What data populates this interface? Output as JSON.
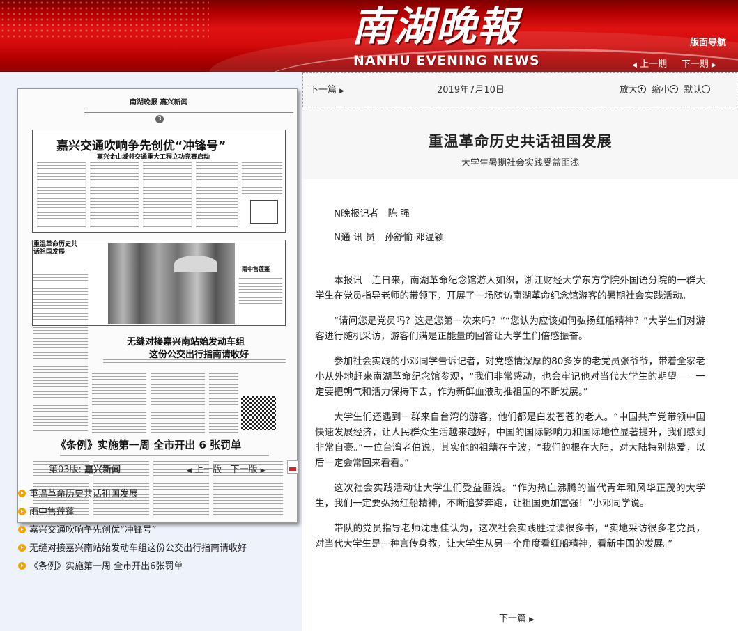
{
  "header": {
    "logo_cn": "南湖晚報",
    "logo_en": "NANHU EVENING NEWS",
    "nav_title": "版面导航",
    "prev_issue": "上一期",
    "next_issue": "下一期"
  },
  "paper_thumb": {
    "masthead": "南湖晚报  嘉兴新闻",
    "page_number": "3",
    "headlines": [
      "嘉兴交通吹响争先创优“冲锋号”",
      "嘉兴金山域邻交通重大工程立功竞赛启动",
      "重温革命历史共话祖国发展",
      "雨中售莲蓬",
      "无缝对接嘉兴南站始发动车组",
      "这份公交出行指南请收好",
      "《条例》实施第一周  全市开出 6 张罚单"
    ]
  },
  "page_nav": {
    "page_label": "第03版:",
    "page_name": "嘉兴新闻",
    "prev_page": "上一版",
    "next_page": "下一版"
  },
  "article_list": [
    "重温革命历史共话祖国发展",
    "雨中售莲蓬",
    "嘉兴交通吹响争先创优“冲锋号”",
    "无缝对接嘉兴南站始发动车组这份公交出行指南请收好",
    "《条例》实施第一周 全市开出6张罚单"
  ],
  "toolbar": {
    "next_article": "下一篇",
    "date": "2019年7月10日",
    "zoom_in": "放大",
    "zoom_out": "缩小",
    "zoom_default": "默认"
  },
  "article": {
    "title": "重温革命历史共话祖国发展",
    "subtitle": "大学生暑期社会实践受益匪浅",
    "byline1": "N晚报记者　陈 强",
    "byline2": "N通 讯 员　孙舒愉 邓温颖",
    "paragraphs": [
      "本报讯　连日来，南湖革命纪念馆游人如织，浙江财经大学东方学院外国语分院的一群大学生在党员指导老师的带领下，开展了一场随访南湖革命纪念馆游客的暑期社会实践活动。",
      "“请问您是党员吗？这是您第一次来吗？”“您认为应该如何弘扬红船精神？”大学生们对游客进行随机采访，游客们满是正能量的回答让大学生们倍感振奋。",
      "参加社会实践的小邓同学告诉记者，对党感情深厚的80多岁的老党员张爷爷，带着全家老小从外地赶来南湖革命纪念馆参观，“我们非常感动，也会牢记他对当代大学生的期望——一定要把朝气和活力保持下去，作为新鲜血液助推祖国的不断发展。”",
      "大学生们还遇到一群来自台湾的游客，他们都是白发苍苍的老人。“中国共产党带领中国快速发展经济，让人民群众生活越来越好，中国的国际影响力和国际地位显著提升，我们感到非常自豪。”一位台湾老伯说，其实他的祖籍在宁波，“我们的根在大陆，对大陆特别热爱，以后一定会常回来看看。”",
      "这次社会实践活动让大学生们受益匪浅。“作为热血沸腾的当代青年和风华正茂的大学生，我们一定要弘扬红船精神，不断追梦奔跑，让祖国更加富强！”小邓同学说。",
      "带队的党员指导老师沈惠佳认为，这次社会实践胜过读很多书，“实地采访很多老党员，对当代大学生是一种言传身教，让大学生从另一个角度看红船精神，看新中国的发展。”"
    ],
    "bottom_next": "下一篇"
  }
}
